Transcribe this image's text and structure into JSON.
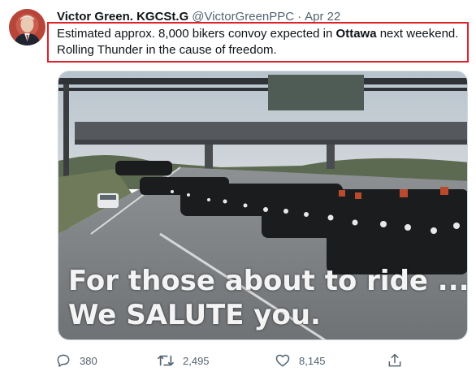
{
  "tweet": {
    "display_name": "Victor Green. KGCSt.G",
    "handle": "@VictorGreenPPC",
    "separator": "·",
    "timestamp": "Apr 22",
    "text_part1": "Estimated approx. 8,000 bikers convoy expected in ",
    "text_bold": "Ottawa",
    "text_part2": " next weekend.",
    "text_line2": "Rolling Thunder in the cause of freedom."
  },
  "image": {
    "caption_line1": "For those about to ride ...",
    "caption_line2": "We SALUTE you."
  },
  "actions": {
    "reply_count": "380",
    "retweet_count": "2,495",
    "like_count": "8,145"
  },
  "colors": {
    "highlight_border": "#e0202a",
    "muted_text": "#536471"
  },
  "icons": {
    "reply": "reply-icon",
    "retweet": "retweet-icon",
    "like": "heart-icon",
    "share": "share-icon"
  }
}
